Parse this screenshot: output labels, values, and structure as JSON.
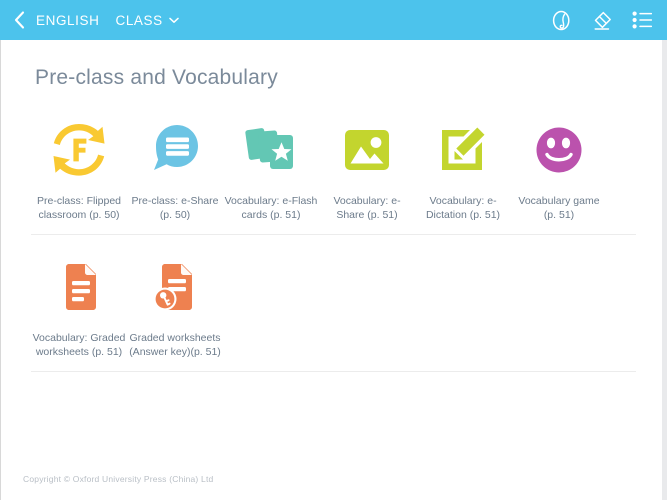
{
  "header": {
    "back_icon": "chevron-left-icon",
    "title": "ENGLISH",
    "class_label": "CLASS",
    "caret_icon": "chevron-down-icon",
    "icons": [
      {
        "name": "annotate-pen-icon",
        "label": "Annotate"
      },
      {
        "name": "eraser-icon",
        "label": "Eraser"
      },
      {
        "name": "list-menu-icon",
        "label": "Menu"
      }
    ],
    "bg_color": "#4cc3ec",
    "text_color": "#ffffff"
  },
  "main": {
    "page_title": "Pre-class and Vocabulary",
    "title_color": "#7b8a9a",
    "rows": [
      {
        "tiles": [
          {
            "icon": "flipped-classroom-icon",
            "color": "#f9c932",
            "label": "Pre-class: Flipped classroom (p. 50)"
          },
          {
            "icon": "speech-bubble-icon",
            "color": "#6cc4e4",
            "label": "Pre-class: e-Share (p. 50)"
          },
          {
            "icon": "flash-cards-icon",
            "color": "#63c7b4",
            "label": "Vocabulary: e-Flash cards (p. 51)"
          },
          {
            "icon": "image-share-icon",
            "color": "#c3d52e",
            "label": "Vocabulary: e-Share (p. 51)"
          },
          {
            "icon": "edit-square-icon",
            "color": "#c3d52e",
            "label": "Vocabulary: e-Dictation (p. 51)"
          },
          {
            "icon": "smiley-face-icon",
            "color": "#bb52ad",
            "label": "Vocabulary game (p. 51)"
          }
        ]
      },
      {
        "tiles": [
          {
            "icon": "document-icon",
            "color": "#ee8150",
            "label": "Vocabulary: Graded worksheets (p. 51)"
          },
          {
            "icon": "document-key-icon",
            "color": "#ee8150",
            "label": "Graded worksheets (Answer key)(p. 51)"
          }
        ]
      }
    ]
  },
  "footer": {
    "copyright": "Copyright © Oxford University Press (China) Ltd"
  }
}
